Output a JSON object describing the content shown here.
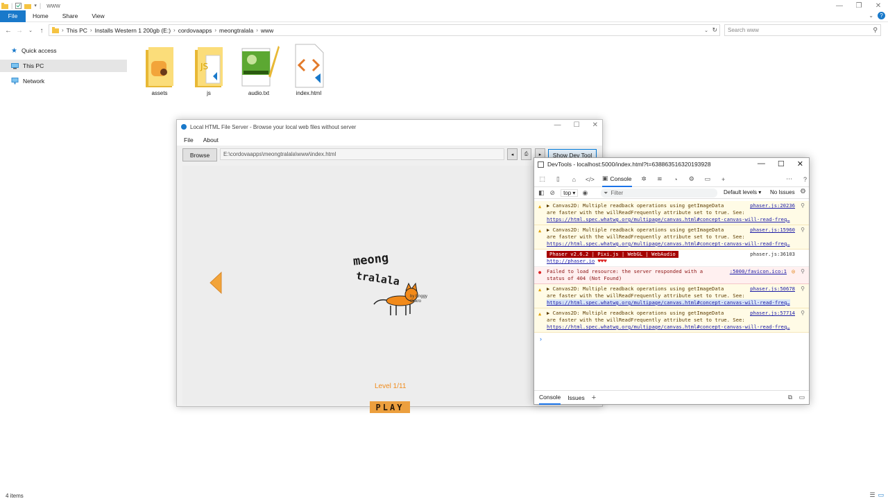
{
  "explorer": {
    "title": "www",
    "ribbon_tabs": [
      "File",
      "Home",
      "Share",
      "View"
    ],
    "breadcrumb": [
      "This PC",
      "Installs Western 1 200gb (E:)",
      "cordovaapps",
      "meongtralala",
      "www"
    ],
    "search_placeholder": "Search www",
    "nav": {
      "quick_access": "Quick access",
      "this_pc": "This PC",
      "network": "Network"
    },
    "files": [
      {
        "name": "assets",
        "icon": "folder-icon"
      },
      {
        "name": "js",
        "icon": "folder-icon"
      },
      {
        "name": "audio.txt",
        "icon": "text-file-icon"
      },
      {
        "name": "index.html",
        "icon": "html-file-icon"
      }
    ],
    "status": "4 items"
  },
  "server": {
    "title": "Local HTML File Server - Browse your local web files without server",
    "menu": [
      "File",
      "About"
    ],
    "browse_label": "Browse",
    "path": "E:\\cordovaapps\\meongtralala\\www\\index.html",
    "back_glyph": "◂",
    "forward_glyph": "▸",
    "print_glyph": "⎙",
    "show_dev_tool": "Show Dev Tool",
    "game": {
      "logo_line1": "meong",
      "logo_line2": "tralala",
      "logo_credit": "by Enggy Cokro",
      "level": "Level 1/11",
      "play": "PLAY"
    }
  },
  "devtools": {
    "title": "DevTools - localhost:5000/index.html?t=638863516320193928",
    "console_tab": "Console",
    "top_context": "top",
    "filter_placeholder": "Filter",
    "levels": "Default levels",
    "issues": "No Issues",
    "messages": [
      {
        "type": "warn",
        "src": "phaser.js:20236",
        "line1": "Canvas2D: Multiple readback operations using getImageData",
        "line2": "are faster with the willReadFrequently attribute set to true. See:",
        "link": "https://html.spec.whatwg.org/multipage/canvas.html#concept-canvas-will-read-freq…"
      },
      {
        "type": "warn",
        "src": "phaser.js:15960",
        "line1": "Canvas2D: Multiple readback operations using getImageData",
        "line2": "are faster with the willReadFrequently attribute set to true. See:",
        "link": "https://html.spec.whatwg.org/multipage/canvas.html#concept-canvas-will-read-freq…"
      },
      {
        "type": "info",
        "src": "phaser.js:36103",
        "banner": "Phaser v2.6.2 | Pixi.js | WebGL | WebAudio",
        "link": "http://phaser.io",
        "hearts": "♥♥♥"
      },
      {
        "type": "err",
        "src": ":5000/favicon.ico:1",
        "line1": "Failed to load resource: the server responded with a",
        "line2": "status of 404 (Not Found)"
      },
      {
        "type": "warn",
        "src": "phaser.js:50678",
        "line1": "Canvas2D: Multiple readback operations using getImageData",
        "line2": "are faster with the willReadFrequently attribute set to true. See:",
        "link": "https://html.spec.whatwg.org/multipage/canvas.html#concept-canvas-will-read-freq…"
      },
      {
        "type": "warn",
        "src": "phaser.js:57714",
        "line1": "Canvas2D: Multiple readback operations using getImageData",
        "line2": "are faster with the willReadFrequently attribute set to true. See:",
        "link": "https://html.spec.whatwg.org/multipage/canvas.html#concept-canvas-will-read-freq…"
      }
    ],
    "drawer_tabs": [
      "Console",
      "Issues"
    ]
  }
}
